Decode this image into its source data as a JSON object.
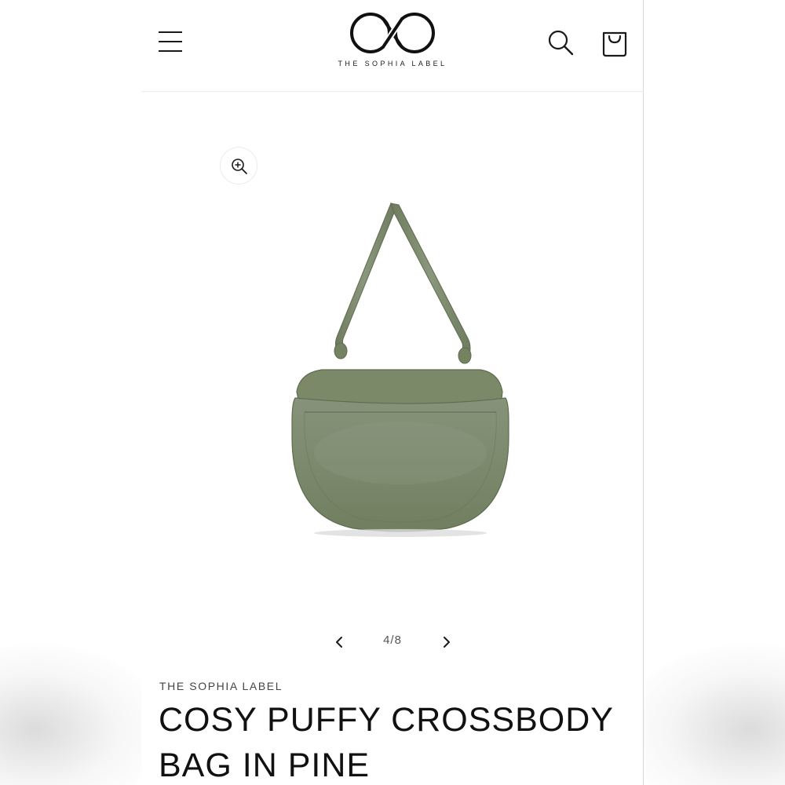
{
  "brand": {
    "name": "THE SOPHIA LABEL",
    "logo_icon": "infinity-x-logo"
  },
  "header": {
    "menu_icon": "hamburger-menu-icon",
    "search_icon": "search-icon",
    "cart_icon": "cart-bag-icon"
  },
  "gallery": {
    "zoom_icon": "zoom-in-icon",
    "image_alt": "Olive green puffy crossbody bag",
    "product_color": "#7d8b6a",
    "pager": {
      "prev_icon": "chevron-left-icon",
      "next_icon": "chevron-right-icon",
      "current": "4/8"
    }
  },
  "product": {
    "vendor": "THE SOPHIA LABEL",
    "title": "COSY PUFFY CROSSBODY BAG IN PINE"
  },
  "colors": {
    "text": "#111111",
    "bag_base": "#7d8b6a",
    "bag_shadow": "#5f6c50",
    "divider": "#ececec"
  }
}
